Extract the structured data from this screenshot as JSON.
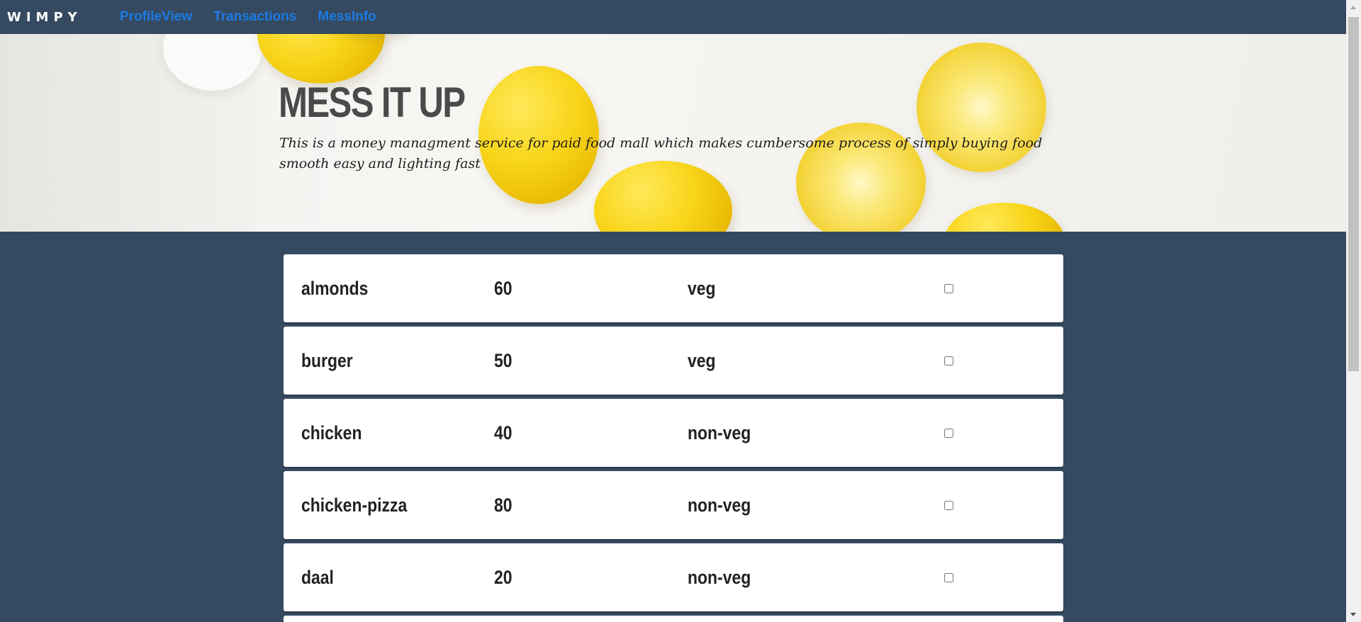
{
  "navbar": {
    "brand": "WIMPY",
    "links": [
      {
        "label": "ProfileView"
      },
      {
        "label": "Transactions"
      },
      {
        "label": "MessInfo"
      }
    ],
    "link_color": "#1a7be6",
    "background": "#354a60"
  },
  "hero": {
    "title": "MESS IT UP",
    "description": "This is a money managment service for paid food mall which makes cumbersome process of simply buying food smooth easy and lighting fast",
    "image": "lemons-background"
  },
  "menu": {
    "items": [
      {
        "name": "almonds",
        "price": "60",
        "type": "veg",
        "selected": false
      },
      {
        "name": "burger",
        "price": "50",
        "type": "veg",
        "selected": false
      },
      {
        "name": "chicken",
        "price": "40",
        "type": "non-veg",
        "selected": false
      },
      {
        "name": "chicken-pizza",
        "price": "80",
        "type": "non-veg",
        "selected": false
      },
      {
        "name": "daal",
        "price": "20",
        "type": "non-veg",
        "selected": false
      }
    ]
  }
}
